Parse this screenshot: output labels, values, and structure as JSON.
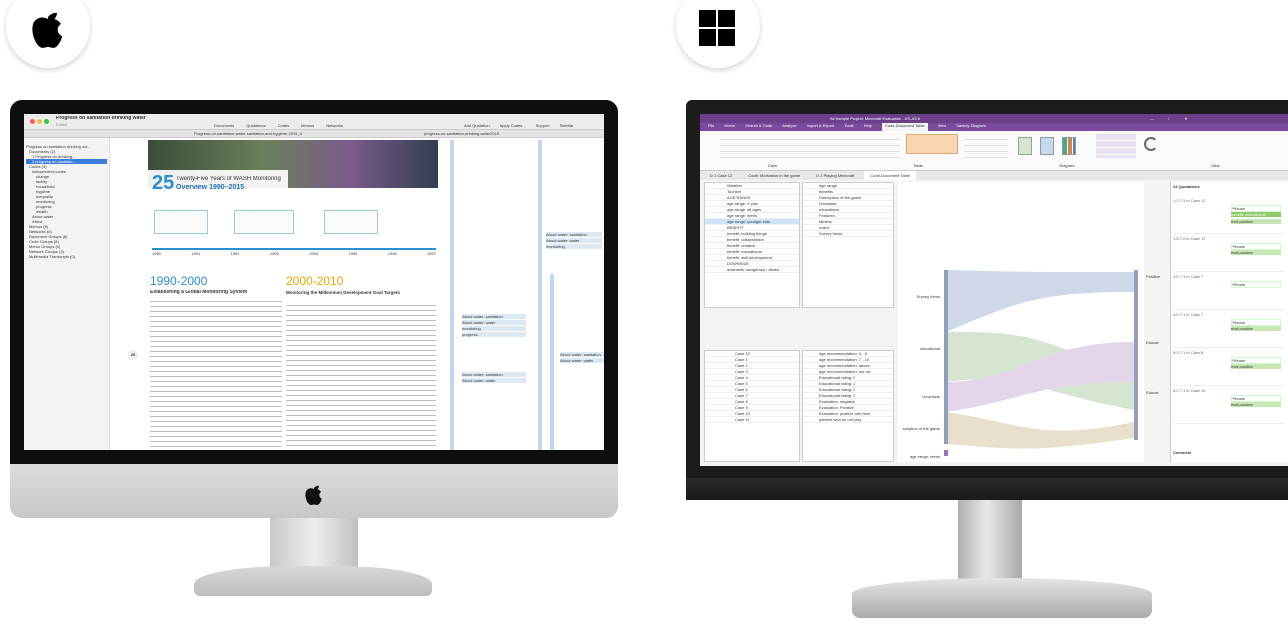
{
  "mac": {
    "window_title": "Progress on sanitation drinking water",
    "window_subtitle": "Edited",
    "toolbar": [
      "Documents",
      "Quotations",
      "Codes",
      "Memos",
      "Networks"
    ],
    "toolbar_right": [
      "Add Quotation",
      "Apply Codes...",
      "Support",
      "Sidebar"
    ],
    "tab_main": "Progress-on-sanitation-water-sanitation-and-hygiene-2019_4",
    "tab_second": "progress-on-sanitation-drinking-water2015",
    "sidebar": [
      "Progress on sanitation drinking wa...",
      "Documents (2)",
      "1 Progress on drinking...",
      "2 progress on sanitatio...",
      "Codes (3)",
      "independent codes",
      "change",
      "facility",
      "household",
      "hygiene",
      "inequality",
      "monitoring",
      "progress",
      "wealth",
      "About water",
      "Africa",
      "Memos (8)",
      "Networks (0)",
      "Document Groups (8)",
      "Code Groups (8)",
      "Memo Groups (0)",
      "Network Groups (3)",
      "Multimedia Transcripts (0)"
    ],
    "doc": {
      "hero_number": "25",
      "hero_title_1": "Twenty-Five Years of WASH Monitoring",
      "hero_title_2": "Overview 1990–2015",
      "years": [
        "1990",
        "1991",
        "1992",
        "1993",
        "1994",
        "1995",
        "1996",
        "1997"
      ],
      "heading_left": "1990-2000",
      "sub_left": "Establishing a Global Monitoring System",
      "heading_right": "2000-2010",
      "sub_right": "Monitoring the Millennium Development Goal Targets",
      "page_number": "26"
    },
    "margin_codes": [
      "About water: sanitation",
      "About water: water",
      "monitoring",
      "progress"
    ]
  },
  "win": {
    "title": "All Sample Project: Minecraft Evaluation - ATLAS.ti",
    "ribbon_tabs": [
      "File",
      "Home",
      "Search & Code",
      "Analyze",
      "Import & Export",
      "Tools",
      "Help",
      "Code-Document Table",
      "View",
      "Sankey Diagram"
    ],
    "ribbon_groups": [
      "Data",
      "Table",
      "Diagram",
      "View"
    ],
    "doc_tabs": [
      "D 1 Case 12",
      "Code: Motivation in the game",
      "D 2 Playing Minecraft",
      "Code-Document Table"
    ],
    "codes": [
      "Weather",
      "Tourism",
      "AGE RANGE",
      "age range: 9 plus",
      "age range: all ages",
      "age range: teens",
      "age range: younger kids",
      "BENEFIT",
      "benefit: building things",
      "benefit: collaboration",
      "benefit: creative",
      "benefit: educational",
      "benefit: skill development",
      "DOWNSIDE",
      "downside: dangerous / dimes"
    ],
    "code_groups": [
      "age range",
      "benefits",
      "Description of the game",
      "Downside",
      "educational",
      "Features",
      "Minitos",
      "online",
      "Survey Items"
    ],
    "documents": [
      "Case 12",
      "Case 1",
      "Case 2",
      "Case 3",
      "Case 4",
      "Case 5",
      "Case 6",
      "Case 7",
      "Case 8",
      "Case 9",
      "Case 10",
      "Case 11"
    ],
    "doc_groups": [
      "age recommendation: 3 - 8",
      "age recommendation: 7 - 10",
      "age recommendation: above",
      "age recommendation: not rec",
      "Educational rating: 0",
      "Educational rating: 1",
      "Educational rating: 2",
      "Educational rating: 3",
      "Evaluation: negative",
      "Evaluation: Positive",
      "Evaluation: positive with limit",
      "parents who do not play"
    ],
    "sankey_left": [
      "Survey Items",
      "educational",
      "Downside",
      "scription of the game",
      "age range: teens"
    ],
    "sankey_right": [
      "Positive",
      "Educat",
      "Educat"
    ],
    "quotations_header": "24 Quotations",
    "quotations": [
      "1:2 7:1 in Case 12",
      "1:8 7:2 in Case 12",
      "4:5 7:1 in Case 7",
      "4:6 7:1 in Case 7",
      "5:3 7:1 in Case 8",
      "6:2 7:1 in Case 10"
    ],
    "quote_codes": [
      "*Reuse",
      "benefit: educational",
      "eval positive"
    ],
    "comment_label": "Comment"
  }
}
